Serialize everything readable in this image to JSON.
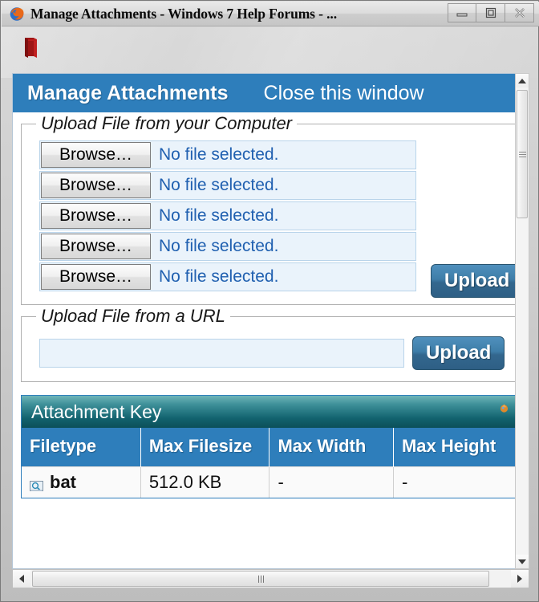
{
  "window": {
    "title": "Manage Attachments - Windows 7 Help Forums - ...",
    "app_icon": "firefox-icon",
    "controls": {
      "minimize": "minimize-icon",
      "maximize": "maximize-icon",
      "close": "close-icon"
    }
  },
  "toolbar": {
    "bookmarks_icon": "bookmarks-book-icon"
  },
  "page": {
    "header": {
      "title": "Manage Attachments",
      "close_link": "Close this window",
      "background_color": "#2e7ebb"
    },
    "upload_computer": {
      "legend": "Upload File from your Computer",
      "rows": [
        {
          "button": "Browse…",
          "status": "No file selected."
        },
        {
          "button": "Browse…",
          "status": "No file selected."
        },
        {
          "button": "Browse…",
          "status": "No file selected."
        },
        {
          "button": "Browse…",
          "status": "No file selected."
        },
        {
          "button": "Browse…",
          "status": "No file selected."
        }
      ],
      "upload_button": "Upload"
    },
    "upload_url": {
      "legend": "Upload File from a URL",
      "input_value": "",
      "input_placeholder": "",
      "upload_button": "Upload"
    },
    "attachment_key": {
      "panel_title": "Attachment Key",
      "collapse_icon": "collapse-arrow-icon",
      "columns": [
        "Filetype",
        "Max Filesize",
        "Max Width",
        "Max Height"
      ],
      "rows": [
        {
          "icon": "file-preview-icon",
          "filetype": "bat",
          "max_filesize": "512.0 KB",
          "max_width": "-",
          "max_height": "-"
        }
      ]
    }
  },
  "scrollbars": {
    "vertical": {
      "up": "scroll-up-arrow-icon",
      "down": "scroll-down-arrow-icon"
    },
    "horizontal": {
      "left": "scroll-left-arrow-icon",
      "right": "scroll-right-arrow-icon"
    }
  }
}
